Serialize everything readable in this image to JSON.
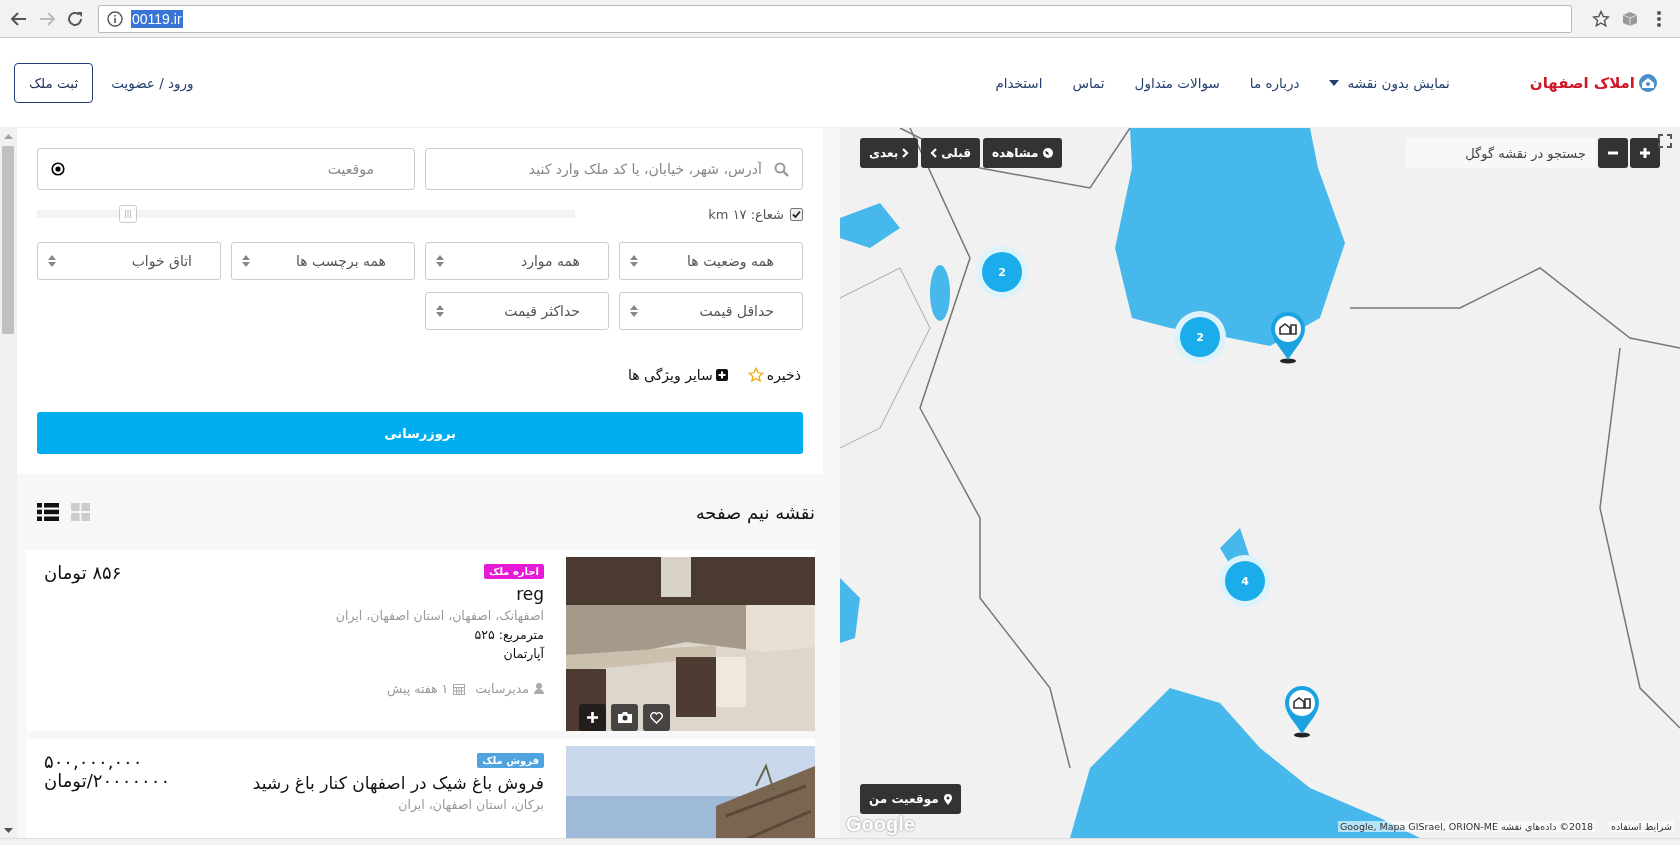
{
  "browser": {
    "url": "00119.ir"
  },
  "header": {
    "logo": "املاک اصفهان",
    "nav": [
      {
        "label": "نمایش بدون نقشه",
        "kind": "dropdown"
      },
      {
        "label": "درباره ما",
        "kind": "link"
      },
      {
        "label": "سوالات متداول",
        "kind": "link"
      },
      {
        "label": "تماس",
        "kind": "link"
      },
      {
        "label": "استخدام",
        "kind": "link"
      }
    ],
    "login": "ورود / عضویت",
    "submit_button": "ثبت ملک"
  },
  "filters": {
    "address_placeholder": "آدرس، شهر، خیابان، یا کد ملک وارد کنید",
    "location_placeholder": "موقعیت",
    "radius": {
      "checked": true,
      "label": "شعاع:",
      "reading": "۱۷ km",
      "level": 0.17
    },
    "selects": [
      "همه وضعیت ها",
      "همه موارد",
      "همه برچسب ها",
      "اتاق خواب",
      "حداقل قیمت",
      "حداکثر قیمت"
    ],
    "save": "ذخیره",
    "more_features": "سایر ویژگی ها",
    "update_button": "بروزرسانی"
  },
  "listings": {
    "title": "نقشه نیم صفحه",
    "views": [
      {
        "kind": "list",
        "selected": true
      },
      {
        "kind": "grid",
        "selected": false
      }
    ],
    "items": [
      {
        "tag": "اجاره ملک",
        "color": "#e619d9",
        "title": "reg",
        "address": "اصفهانک، اصفهان، استان اصفهان، ایران",
        "area": "مترمربع: ۵۲۵",
        "type": "آپارتمان",
        "agent": "مدیرسایت",
        "date": "۱ هفته پیش",
        "price": [
          "۸۵۶ تومان"
        ]
      },
      {
        "tag": "فروش ملک",
        "color": "#4fa3de",
        "title": "فروش باغ شیک در اصفهان کنار باغ رشید",
        "address": "برکان، استان اصفهان، ایران",
        "price": [
          "۵۰۰,۰۰۰,۰۰۰",
          "۲۰۰۰۰۰۰۰/تومان"
        ]
      }
    ]
  },
  "map": {
    "nav_buttons": [
      {
        "label": "مشاهده",
        "kind": "view"
      },
      {
        "label": "قبلی",
        "kind": "prev"
      },
      {
        "label": "بعدی",
        "kind": "next"
      }
    ],
    "search_placeholder": "جستجو در نقشه گوگل",
    "clusters": [
      {
        "count": "2"
      },
      {
        "count": "2"
      },
      {
        "count": "4"
      }
    ],
    "my_location": "موقعیت من",
    "logo": "Google",
    "attribution": "2018© داده‌های نقشه Google, Mapa GISrael, ORION-ME",
    "terms": "شرایط استفاده"
  }
}
